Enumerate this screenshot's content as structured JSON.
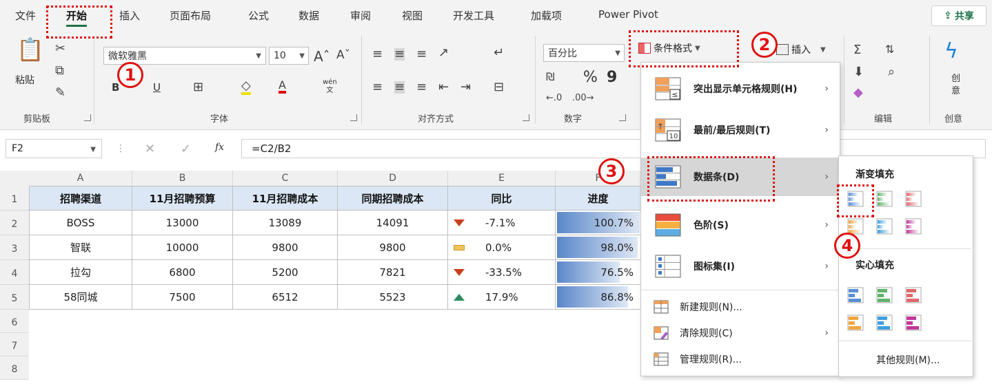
{
  "tabs": [
    "文件",
    "开始",
    "插入",
    "页面布局",
    "公式",
    "数据",
    "审阅",
    "视图",
    "开发工具",
    "加载项",
    "Power Pivot"
  ],
  "share_label": "共享",
  "ribbon": {
    "clipboard": {
      "paste_label": "粘贴",
      "group_label": "剪贴板"
    },
    "font": {
      "name": "微软雅黑",
      "size": "10",
      "bold": "B",
      "underline": "U",
      "pinyin": "wén\n文",
      "group_label": "字体"
    },
    "align": {
      "group_label": "对齐方式"
    },
    "number": {
      "format": "百分比",
      "percent": "%",
      "comma": "9",
      "group_label": "数字"
    },
    "styles": {
      "conditional_format_label": "条件格式"
    },
    "cells": {
      "insert_label": "插入"
    },
    "editing": {
      "group_label": "编辑"
    },
    "ideas": {
      "label": "创\n意",
      "group_label": "创意"
    }
  },
  "formula_bar": {
    "name_box": "F2",
    "fx": "fx",
    "formula": "=C2/B2"
  },
  "sheet": {
    "columns": [
      "A",
      "B",
      "C",
      "D",
      "E",
      "F"
    ],
    "rows": [
      "1",
      "2",
      "3",
      "4",
      "5",
      "6",
      "7",
      "8"
    ],
    "headers": [
      "招聘渠道",
      "11月招聘预算",
      "11月招聘成本",
      "同期招聘成本",
      "同比",
      "进度"
    ],
    "data": [
      {
        "channel": "BOSS",
        "budget": "13000",
        "cost": "13089",
        "prior": "14091",
        "yoy": "-7.1%",
        "trend": "down",
        "progress": "100.7%",
        "progress_value": 1.007
      },
      {
        "channel": "智联",
        "budget": "10000",
        "cost": "9800",
        "prior": "9800",
        "yoy": "0.0%",
        "trend": "flat",
        "progress": "98.0%",
        "progress_value": 0.98
      },
      {
        "channel": "拉勾",
        "budget": "6800",
        "cost": "5200",
        "prior": "7821",
        "yoy": "-33.5%",
        "trend": "down",
        "progress": "76.5%",
        "progress_value": 0.765
      },
      {
        "channel": "58同城",
        "budget": "7500",
        "cost": "6512",
        "prior": "5523",
        "yoy": "17.9%",
        "trend": "up",
        "progress": "86.8%",
        "progress_value": 0.868
      }
    ]
  },
  "cf_menu": {
    "items": [
      {
        "label": "突出显示单元格规则(H)",
        "icon": "highlight-rules-icon",
        "arrow": true
      },
      {
        "label": "最前/最后规则(T)",
        "icon": "top-bottom-icon",
        "arrow": true
      },
      {
        "label": "数据条(D)",
        "icon": "data-bars-icon",
        "arrow": true
      },
      {
        "label": "色阶(S)",
        "icon": "color-scales-icon",
        "arrow": true
      },
      {
        "label": "图标集(I)",
        "icon": "icon-sets-icon",
        "arrow": true
      }
    ],
    "small_items": [
      {
        "label": "新建规则(N)...",
        "icon": "new-rule-icon",
        "arrow": false
      },
      {
        "label": "清除规则(C)",
        "icon": "clear-rules-icon",
        "arrow": true
      },
      {
        "label": "管理规则(R)...",
        "icon": "manage-rules-icon",
        "arrow": false
      }
    ]
  },
  "data_bar_submenu": {
    "gradient_title": "渐变填充",
    "solid_title": "实心填充",
    "more_rules": "其他规则(M)...",
    "colors": [
      "#5b8fd6",
      "#5fb36a",
      "#e0686c",
      "#f0a640",
      "#3ea0e0",
      "#c2389a"
    ]
  },
  "annotations": [
    "1",
    "2",
    "3",
    "4"
  ],
  "colors": {
    "ribbon_bg": "#f3f3f3",
    "header_fill": "#dbe7f5",
    "accent_green": "#1e7145",
    "annotation_red": "#e01010",
    "bar_blue": "#5a87c9"
  }
}
